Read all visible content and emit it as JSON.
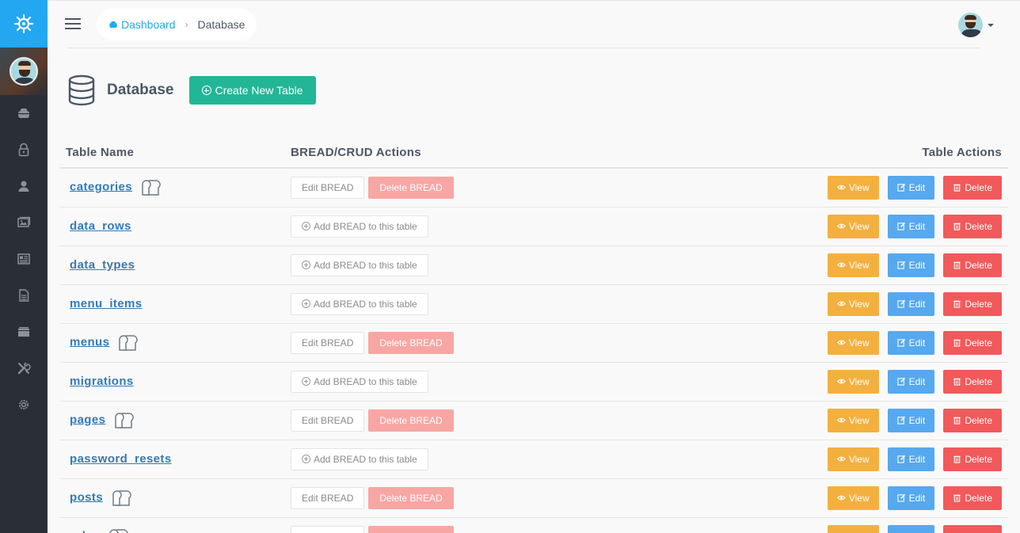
{
  "sidebar": {
    "brand_icon": "helm-icon",
    "items": [
      {
        "icon": "dashboard-icon"
      },
      {
        "icon": "lock-icon"
      },
      {
        "icon": "user-icon"
      },
      {
        "icon": "images-icon"
      },
      {
        "icon": "news-icon"
      },
      {
        "icon": "file-icon"
      },
      {
        "icon": "folder-icon"
      },
      {
        "icon": "tools-icon"
      },
      {
        "icon": "settings-icon"
      }
    ]
  },
  "breadcrumb": {
    "home": "Dashboard",
    "current": "Database"
  },
  "page": {
    "title": "Database",
    "create_button": "Create New Table"
  },
  "table": {
    "headers": {
      "name": "Table Name",
      "bread": "BREAD/CRUD Actions",
      "actions": "Table Actions"
    },
    "buttons": {
      "edit_bread": "Edit BREAD",
      "delete_bread": "Delete BREAD",
      "add_bread": "Add BREAD to this table",
      "view": "View",
      "edit": "Edit",
      "delete": "Delete"
    },
    "rows": [
      {
        "name": "categories",
        "has_bread": true
      },
      {
        "name": "data_rows",
        "has_bread": false
      },
      {
        "name": "data_types",
        "has_bread": false
      },
      {
        "name": "menu_items",
        "has_bread": false
      },
      {
        "name": "menus",
        "has_bread": true
      },
      {
        "name": "migrations",
        "has_bread": false
      },
      {
        "name": "pages",
        "has_bread": true
      },
      {
        "name": "password_resets",
        "has_bread": false
      },
      {
        "name": "posts",
        "has_bread": true
      },
      {
        "name": "roles",
        "has_bread": true
      }
    ]
  },
  "colors": {
    "brand": "#22a7f0",
    "sidebar": "#2a2f35",
    "create": "#22b697",
    "view": "#f4b03e",
    "edit": "#56a8ef",
    "delete": "#f2595b"
  }
}
